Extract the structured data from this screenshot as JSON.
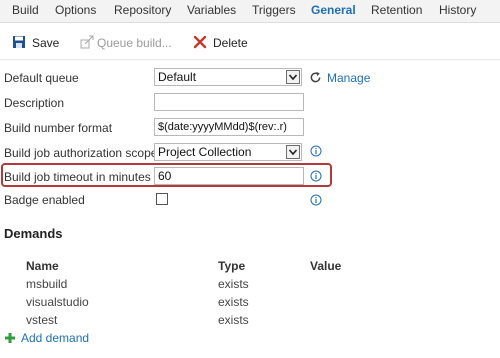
{
  "tabs": [
    {
      "label": "Build"
    },
    {
      "label": "Options"
    },
    {
      "label": "Repository"
    },
    {
      "label": "Variables"
    },
    {
      "label": "Triggers"
    },
    {
      "label": "General",
      "active": true
    },
    {
      "label": "Retention"
    },
    {
      "label": "History"
    }
  ],
  "toolbar": {
    "save_label": "Save",
    "queue_build_label": "Queue build...",
    "delete_label": "Delete"
  },
  "fields": {
    "default_queue": {
      "label": "Default queue",
      "value": "Default",
      "action_label": "Manage"
    },
    "description": {
      "label": "Description",
      "value": ""
    },
    "build_number_format": {
      "label": "Build number format",
      "value": "$(date:yyyyMMdd)$(rev:.r)"
    },
    "auth_scope": {
      "label": "Build job authorization scope",
      "value": "Project Collection"
    },
    "timeout": {
      "label": "Build job timeout in minutes",
      "value": "60"
    },
    "badge": {
      "label": "Badge enabled",
      "checked": false
    }
  },
  "demands": {
    "title": "Demands",
    "columns": [
      "Name",
      "Type",
      "Value"
    ],
    "rows": [
      {
        "name": "msbuild",
        "type": "exists",
        "value": ""
      },
      {
        "name": "visualstudio",
        "type": "exists",
        "value": ""
      },
      {
        "name": "vstest",
        "type": "exists",
        "value": ""
      }
    ],
    "add_label": "Add demand"
  },
  "colors": {
    "accent": "#1f6fb5",
    "highlight": "#b23a3a",
    "delete_icon": "#c0392b",
    "add_icon": "#2e9e3e"
  },
  "icons": {
    "save": "save-icon",
    "queue_build": "queue-build-icon",
    "delete": "delete-icon",
    "refresh": "refresh-icon",
    "info": "info-icon",
    "add": "plus-icon"
  }
}
